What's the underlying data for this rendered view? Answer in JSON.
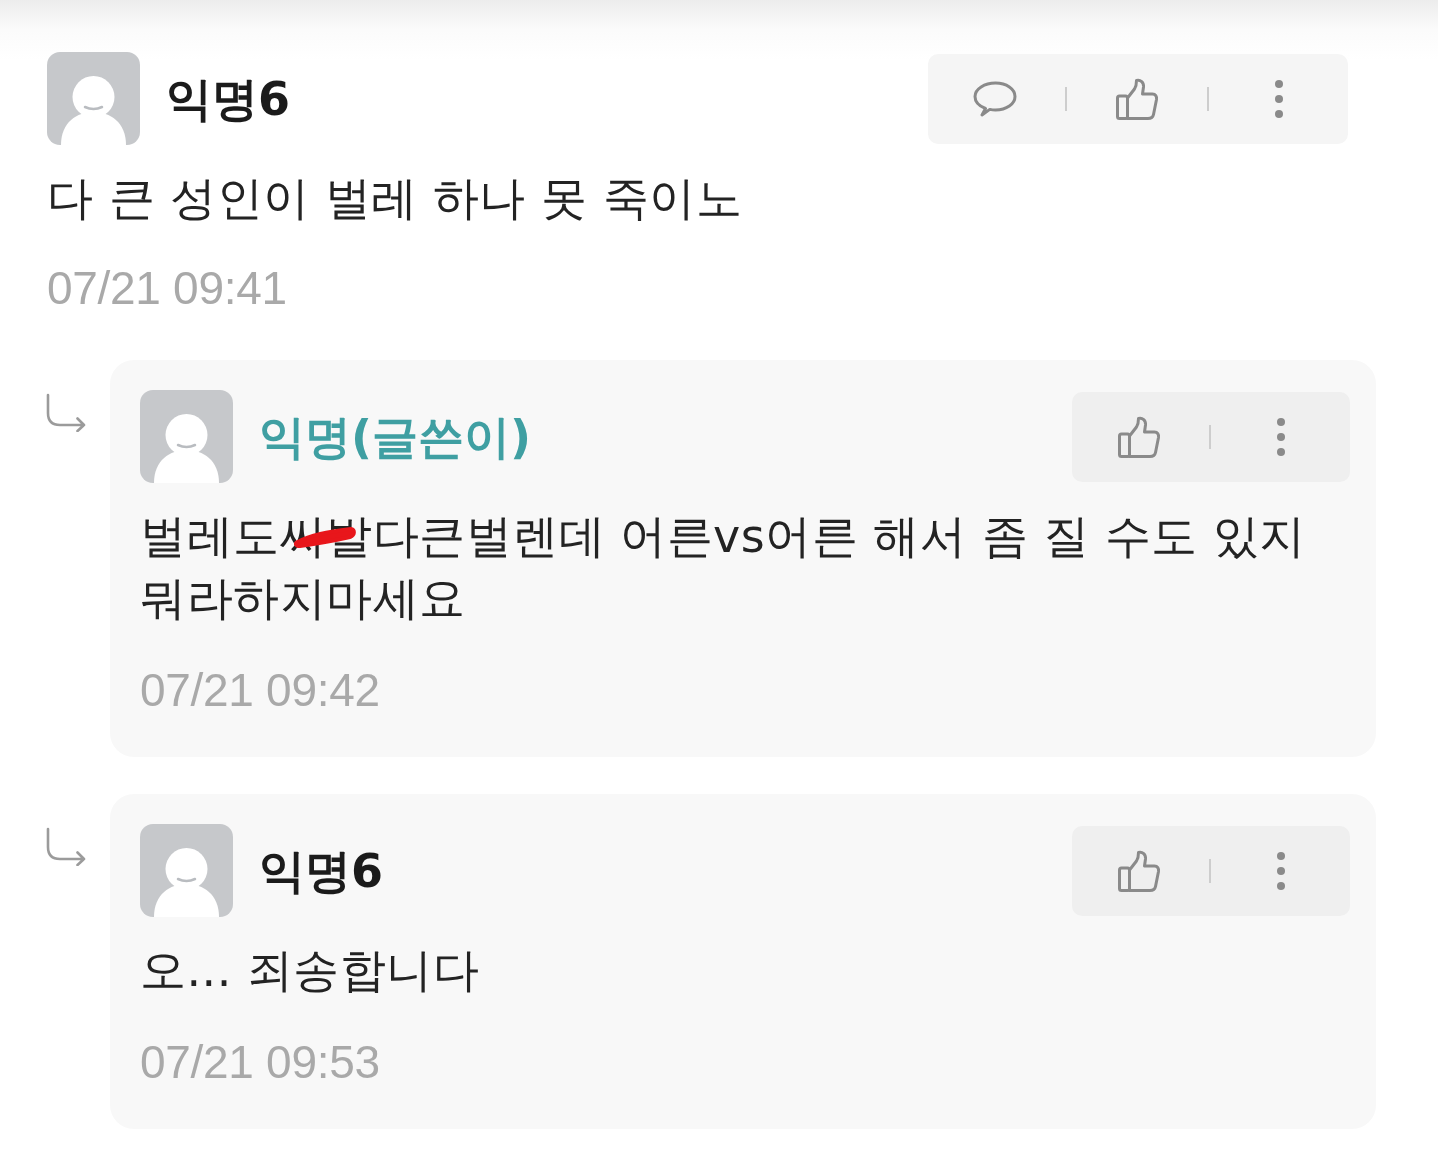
{
  "thread": {
    "comment": {
      "author": "익명6",
      "is_writer": false,
      "reply_button": true,
      "text": "다 큰 성인이 벌레 하나 못 죽이노",
      "censor_mark": false,
      "time": "07/21 09:41",
      "replies": [
        {
          "author": "익명(글쓴이)",
          "is_writer": true,
          "reply_button": false,
          "text": "벌레도씨발다큰벌렌데 어른vs어른 해서 좀 질 수도 있지 뭐라하지마세요",
          "censor_mark": true,
          "time": "07/21 09:42"
        },
        {
          "author": "익명6",
          "is_writer": false,
          "reply_button": false,
          "text": "오... 죄송합니다",
          "censor_mark": false,
          "time": "07/21 09:53"
        }
      ]
    }
  }
}
